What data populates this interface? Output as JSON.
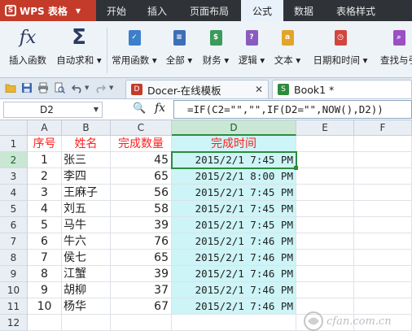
{
  "app": {
    "name": "WPS 表格"
  },
  "menu": [
    "开始",
    "插入",
    "页面布局",
    "公式",
    "数据",
    "表格样式"
  ],
  "ribbon": {
    "insert_function": "插入函数",
    "autosum": "自动求和",
    "common_functions": "常用函数",
    "all": "全部",
    "finance": "财务",
    "logic": "逻辑",
    "text": "文本",
    "datetime": "日期和时间",
    "lookup": "查找与引"
  },
  "tabs": {
    "docer": "Docer-在线模板",
    "book": "Book1 *"
  },
  "formula_bar": {
    "name_box": "D2",
    "fx": "fx",
    "formula": "=IF(C2=\"\",\"\",IF(D2=\"\",NOW(),D2))"
  },
  "grid": {
    "columns": [
      "A",
      "B",
      "C",
      "D",
      "E",
      "F"
    ],
    "row_numbers": [
      "1",
      "2",
      "3",
      "4",
      "5",
      "6",
      "7",
      "8",
      "9",
      "10",
      "11",
      "12"
    ],
    "header": [
      "序号",
      "姓名",
      "完成数量",
      "完成时间"
    ],
    "rows": [
      [
        "1",
        "张三",
        "45",
        "2015/2/1  7:45 PM"
      ],
      [
        "2",
        "李四",
        "65",
        "2015/2/1  8:00 PM"
      ],
      [
        "3",
        "王麻子",
        "56",
        "2015/2/1  7:45 PM"
      ],
      [
        "4",
        "刘五",
        "58",
        "2015/2/1  7:45 PM"
      ],
      [
        "5",
        "马牛",
        "39",
        "2015/2/1  7:45 PM"
      ],
      [
        "6",
        "牛六",
        "76",
        "2015/2/1  7:46 PM"
      ],
      [
        "7",
        "侯七",
        "65",
        "2015/2/1  7:46 PM"
      ],
      [
        "8",
        "江蟹",
        "39",
        "2015/2/1  7:46 PM"
      ],
      [
        "9",
        "胡柳",
        "37",
        "2015/2/1  7:46 PM"
      ],
      [
        "10",
        "杨华",
        "67",
        "2015/2/1  7:46 PM"
      ]
    ]
  },
  "watermark": "cfan.com.cn",
  "colors": {
    "accent_red": "#c43b2a",
    "header_text": "#ff2020",
    "selection": "#2e8b3c",
    "cyan_fill": "#cdf4f6"
  }
}
